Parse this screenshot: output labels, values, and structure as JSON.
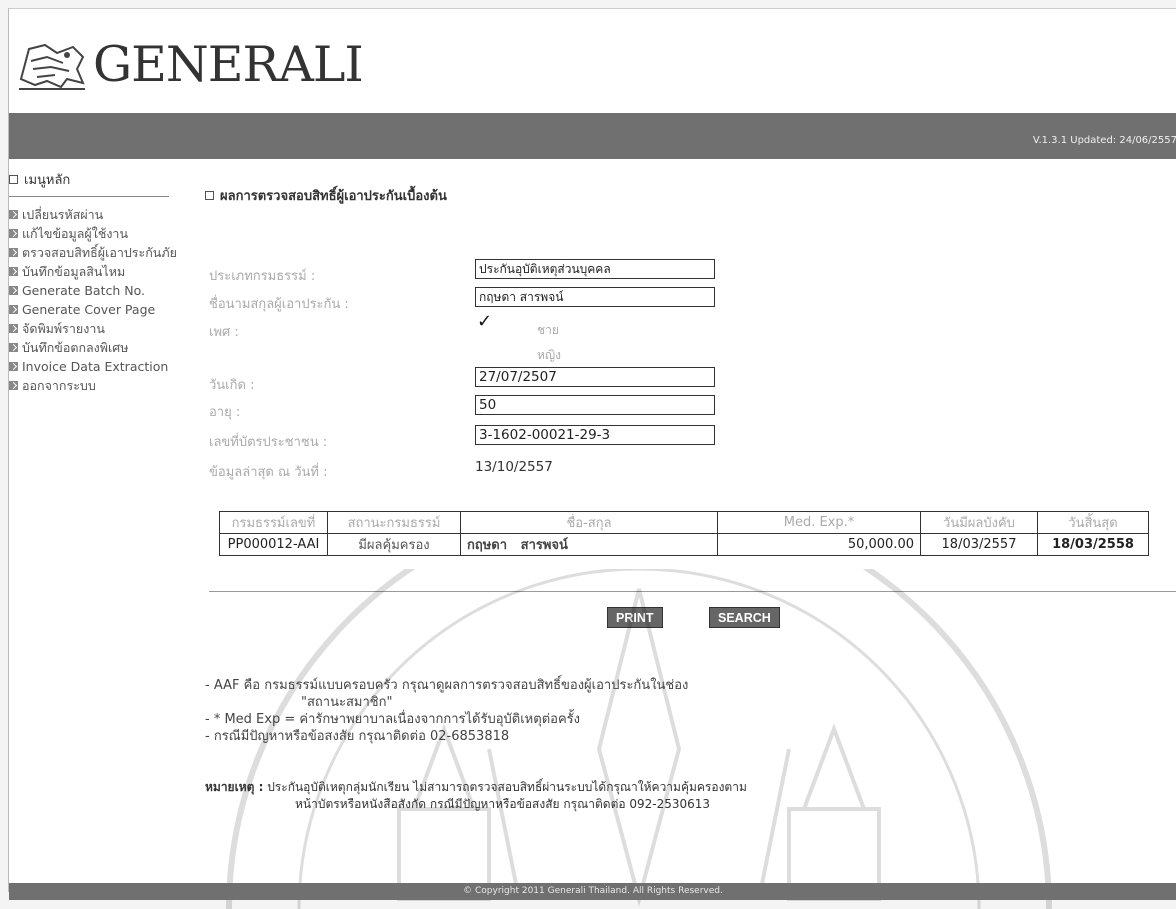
{
  "header": {
    "brand": "GENERALI",
    "version": "V.1.3.1  Updated: 24/06/2557"
  },
  "sidebar": {
    "title": "เมนูหลัก",
    "items": [
      {
        "label": "เปลี่ยนรหัสผ่าน",
        "icon": "arrow-icon"
      },
      {
        "label": "แก้ไขข้อมูลผู้ใช้งาน",
        "icon": "arrow-icon"
      },
      {
        "label": "ตรวจสอบสิทธิ์ผู้เอาประกันภัย",
        "icon": "arrow-icon"
      },
      {
        "label": "บันทึกข้อมูลสินไหม",
        "icon": "arrow-icon"
      },
      {
        "label": "Generate Batch No.",
        "icon": "arrow-icon"
      },
      {
        "label": "Generate Cover Page",
        "icon": "arrow-icon"
      },
      {
        "label": "จัดพิมพ์รายงาน",
        "icon": "arrow-icon"
      },
      {
        "label": "บันทึกข้อตกลงพิเศษ",
        "icon": "arrow-icon"
      },
      {
        "label": "Invoice Data Extraction",
        "icon": "arrow-icon"
      },
      {
        "label": "ออกจากระบบ",
        "icon": "arrow-icon"
      }
    ]
  },
  "main": {
    "title": "ผลการตรวจสอบสิทธิ์ผู้เอาประกันเบื้องต้น",
    "form": {
      "policy_type_label": "ประเภทกรมธรรม์ :",
      "policy_type_value": "ประกันอุบัติเหตุส่วนบุคคล",
      "name_label": "ชื่อนามสกุลผู้เอาประกัน :",
      "name_value": "กฤษดา สารพจน์",
      "sex_label": "เพศ :",
      "sex_male": "ชาย",
      "sex_female": "หญิง",
      "sex_selected": "ชาย",
      "birth_label": "วันเกิด :",
      "birth_value": "27/07/2507",
      "age_label": "อายุ :",
      "age_value": "50",
      "id_label": "เลขที่บัตรประชาชน :",
      "id_value": "3-1602-00021-29-3",
      "latest_label": "ข้อมูลล่าสุด ณ วันที่ :",
      "latest_value": "13/10/2557"
    },
    "table": {
      "headers": [
        "กรมธรรม์เลขที่",
        "สถานะกรมธรรม์",
        "ชื่อ-สกุล",
        "Med. Exp.*",
        "วันมีผลบังคับ",
        "วันสิ้นสุด"
      ],
      "rows": [
        [
          "PP000012-AAI",
          "มีผลคุ้มครอง",
          "กฤษดา   สารพจน์",
          "50,000.00",
          "18/03/2557",
          "18/03/2558"
        ]
      ]
    },
    "buttons": {
      "print": "PRINT",
      "search": "SEARCH"
    },
    "notes": {
      "line1": "- AAF คือ  กรมธรรม์แบบครอบครัว  กรุณาดูผลการตรวจสอบสิทธิ์ของผู้เอาประกันในช่อง",
      "line1b": "\"สถานะสมาชิก\"",
      "line2": "- * Med Exp = ค่ารักษาพยาบาลเนื่องจากการได้รับอุบัติเหตุต่อครั้ง",
      "line3": "- กรณีมีปัญหาหรือข้อสงสัย  กรุณาติดต่อ  02-6853818"
    },
    "remark": {
      "label": "หมายเหตุ :",
      "line1": " ประกันอุบัติเหตุกลุ่มนักเรียน ไม่สามารถตรวจสอบสิทธิ์ผ่านระบบได้กรุณาให้ความคุ้มครองตาม",
      "line2": "หน้าบัตรหรือหนังสือสังกัด กรณีมีปัญหาหรือข้อสงสัย กรุณาติดต่อ 092-2530613"
    }
  },
  "footer": {
    "copyright": "© Copyright 2011 Generali Thailand. All Rights Reserved."
  },
  "colors": {
    "bar": "#707070",
    "button": "#666666"
  }
}
